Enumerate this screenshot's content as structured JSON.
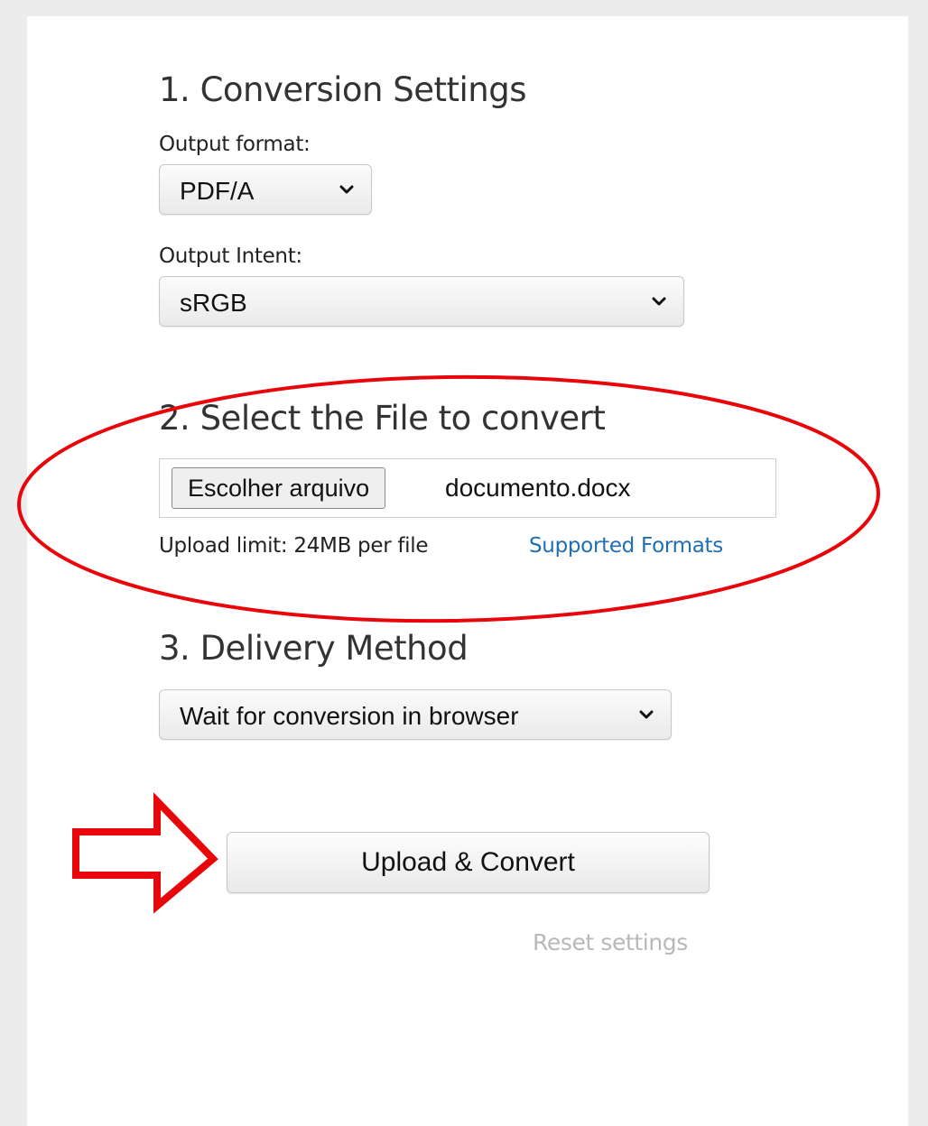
{
  "step1": {
    "title": "1. Conversion Settings",
    "output_format_label": "Output format:",
    "output_format_value": "PDF/A",
    "output_intent_label": "Output Intent:",
    "output_intent_value": "sRGB"
  },
  "step2": {
    "title": "2. Select the File to convert",
    "choose_file_label": "Escolher arquivo",
    "file_name": "documento.docx",
    "upload_limit": "Upload limit: 24MB per file",
    "supported_formats_link": "Supported Formats"
  },
  "step3": {
    "title": "3. Delivery Method",
    "delivery_value": "Wait for conversion in browser"
  },
  "actions": {
    "convert_label": "Upload & Convert",
    "reset_label": "Reset settings"
  },
  "colors": {
    "annotation": "#e8060b",
    "link": "#1f6fb2",
    "muted_link": "#b8b8b8"
  },
  "icons": {
    "select_arrow": "chevron-down-icon",
    "highlight": "ellipse-highlight",
    "pointer": "right-arrow-annotation"
  }
}
